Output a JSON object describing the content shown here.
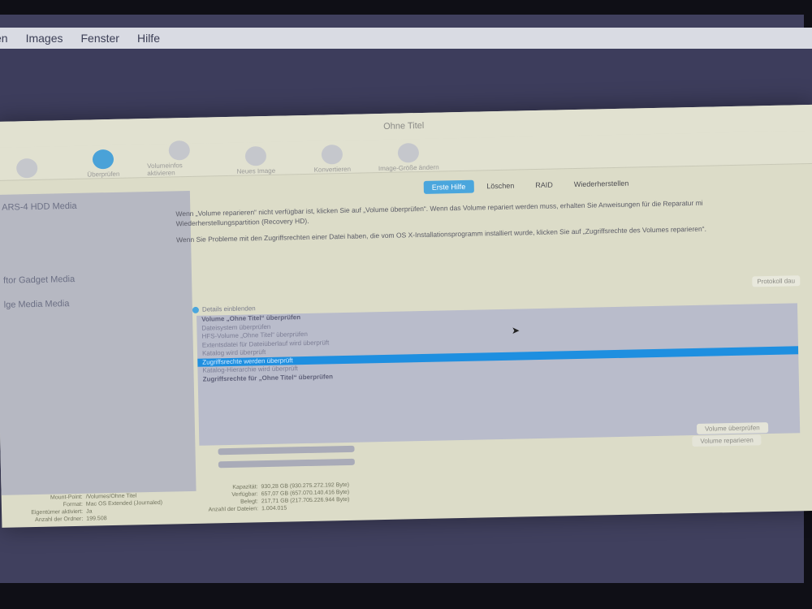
{
  "menubar": {
    "items": [
      "en",
      "Images",
      "Fenster",
      "Hilfe"
    ]
  },
  "window": {
    "title": "Ohne Titel",
    "toolbar": [
      "",
      "Überprüfen",
      "Volumeinfos aktivieren",
      "Neues Image",
      "Konvertieren",
      "Image-Größe ändern"
    ]
  },
  "sidebar": {
    "items": [
      "ARS-4 HDD Media",
      "ftor Gadget Media",
      "lge Media Media"
    ]
  },
  "tabs": [
    "Erste Hilfe",
    "Löschen",
    "RAID",
    "Wiederherstellen"
  ],
  "text": {
    "p1": "Wenn „Volume reparieren“ nicht verfügbar ist, klicken Sie auf „Volume überprüfen“. Wenn das Volume repariert werden muss, erhalten Sie Anweisungen für die Reparatur mi",
    "p1b": "Wiederherstellungspartition (Recovery HD).",
    "p2": "Wenn Sie Probleme mit den Zugriffsrechten einer Datei haben, die vom OS X-Installationsprogramm installiert wurde, klicken Sie auf „Zugriffsrechte des Volumes reparieren“."
  },
  "protocol_button": "Protokoll dau",
  "details_label": "Details einblenden",
  "log": [
    "Volume „Ohne Titel“ überprüfen",
    "Dateisystem überprüfen",
    "HFS-Volume „Ohne Titel“ überprüfen",
    "Extentsdatei für Dateiüberlauf wird überprüft",
    "Katalog wird überprüft",
    "Zugriffsrechte werden überprüft",
    "Katalog-Hierarchie wird überprüft",
    "Zugriffsrechte für „Ohne Titel“ überprüfen",
    "",
    "",
    "",
    "",
    "",
    "",
    ""
  ],
  "buttons": {
    "verify": "Volume überprüfen",
    "repair": "Volume reparieren"
  },
  "info_left": {
    "labels": [
      "Mount-Point:",
      "Format:",
      "Eigentümer aktiviert:",
      "Anzahl der Ordner:"
    ],
    "values": [
      "/Volumes/Ohne Titel",
      "Mac OS Extended (Journaled)",
      "Ja",
      "199.508"
    ]
  },
  "info_right": {
    "labels": [
      "Kapazität:",
      "Verfügbar:",
      "Belegt:",
      "Anzahl der Dateien:"
    ],
    "values": [
      "930,28 GB (930.275.272.192 Byte)",
      "657,07 GB (657.070.140.416 Byte)",
      "217,71 GB (217.705.226.944 Byte)",
      "1.004.015"
    ]
  }
}
